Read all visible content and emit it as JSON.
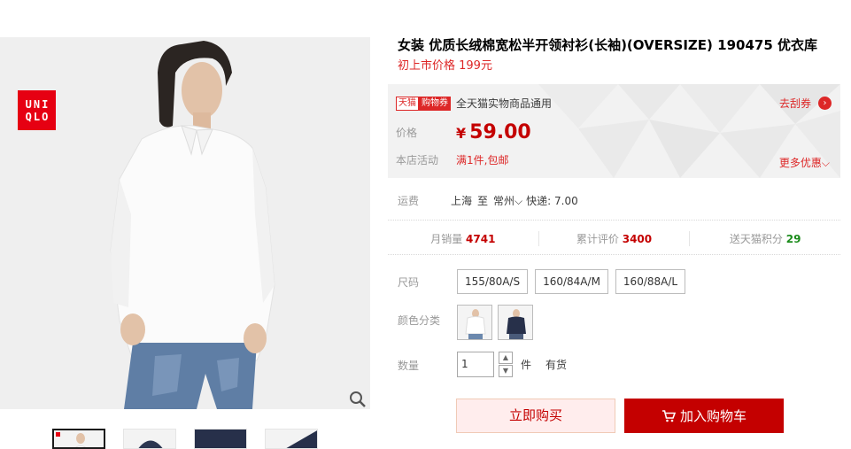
{
  "brand": {
    "logo_line1": "UNI",
    "logo_line2": "QLO"
  },
  "product": {
    "title": "女装 优质长绒棉宽松半开领衬衫(长袖)(OVERSIZE) 190475 优衣库",
    "initial_price_text": "初上市价格 199元"
  },
  "promo": {
    "tmall_badge": "天猫",
    "coupon_badge": "购物券",
    "coupon_desc": "全天猫实物商品通用",
    "get_coupon_label": "去刮券",
    "price_label": "价格",
    "currency": "¥",
    "price": "59.00",
    "activity_label": "本店活动",
    "activity_value": "满1件,包邮",
    "more_deals": "更多优惠"
  },
  "shipping": {
    "label": "运费",
    "from": "上海",
    "to_word": "至",
    "dest": "常州",
    "fee_text": "快递: 7.00"
  },
  "stats": {
    "monthly_sales_label": "月销量",
    "monthly_sales": "4741",
    "reviews_label": "累计评价",
    "reviews": "3400",
    "points_label": "送天猫积分",
    "points": "29"
  },
  "options": {
    "size_label": "尺码",
    "sizes": [
      "155/80A/S",
      "160/84A/M",
      "160/88A/L"
    ],
    "color_label": "颜色分类",
    "colors": [
      "white",
      "navy"
    ]
  },
  "quantity": {
    "label": "数量",
    "value": "1",
    "unit": "件",
    "stock": "有货"
  },
  "actions": {
    "buy_now": "立即购买",
    "add_to_cart": "加入购物车"
  },
  "colors": {
    "accent": "#c40000",
    "promo_red": "#dd2727",
    "logo_red": "#e60012",
    "points_green": "#1c8c1c"
  }
}
